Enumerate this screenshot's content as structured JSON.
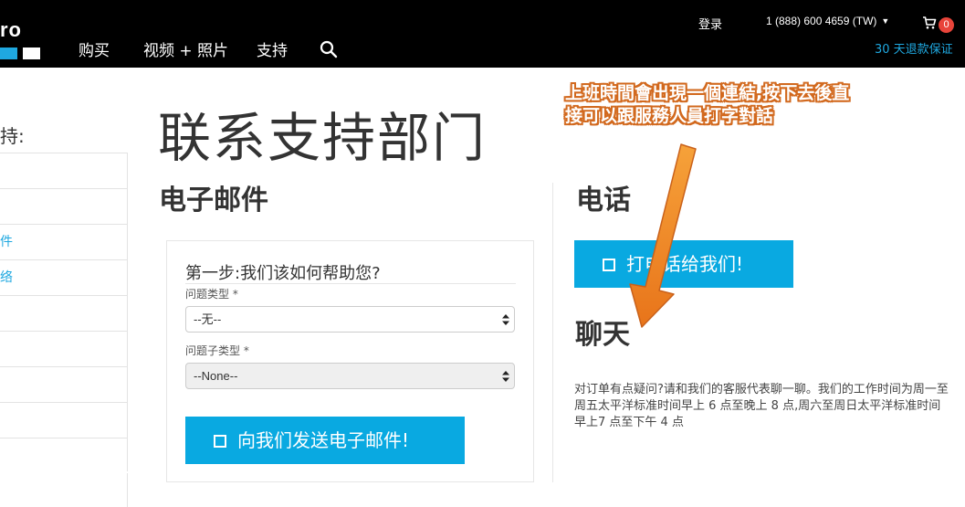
{
  "header": {
    "logo_text": "ro",
    "nav": [
      {
        "label": "购买"
      },
      {
        "label": "视频 + 照片"
      },
      {
        "label": "支持"
      }
    ],
    "login_label": "登录",
    "phone_label": "1 (888) 600 4659 (TW)",
    "cart_count": "0",
    "guarantee_label": "30 天退款保证",
    "search_icon": "search-icon",
    "cart_icon": "cart-icon"
  },
  "sidebar": {
    "title": "支持:",
    "items": [
      {
        "label": ""
      },
      {
        "label": ""
      },
      {
        "label": "件"
      },
      {
        "label": "络"
      },
      {
        "label": ""
      },
      {
        "label": ""
      },
      {
        "label": ""
      },
      {
        "label": ""
      },
      {
        "label": ""
      }
    ]
  },
  "page": {
    "title": "联系支持部门"
  },
  "email": {
    "heading": "电子邮件",
    "step_title": "第一步:我们该如何帮助您?",
    "problem_type_label": "问题类型 *",
    "problem_type_value": "--无--",
    "problem_subtype_label": "问题子类型 *",
    "problem_subtype_value": "--None--",
    "send_button_label": "向我们发送电子邮件!"
  },
  "phone": {
    "heading": "电话",
    "call_button_label": "打电话给我们!"
  },
  "chat": {
    "heading": "聊天",
    "description": "对订单有点疑问?请和我们的客服代表聊一聊。我们的工作时间为周一至周五太平洋标准时间早上 6 点至晚上 8 点,周六至周日太平洋标准时间早上7 点至下午 4 点"
  },
  "annotation": {
    "text": "上班時間會出現一個連結,按下去後直接可以跟服務人員打字對話"
  },
  "colors": {
    "header_bg": "#000000",
    "accent_blue": "#09a9e1",
    "link_blue": "#1fa8e0",
    "badge_red": "#e8443a",
    "annotation_orange": "#f28a1f"
  }
}
